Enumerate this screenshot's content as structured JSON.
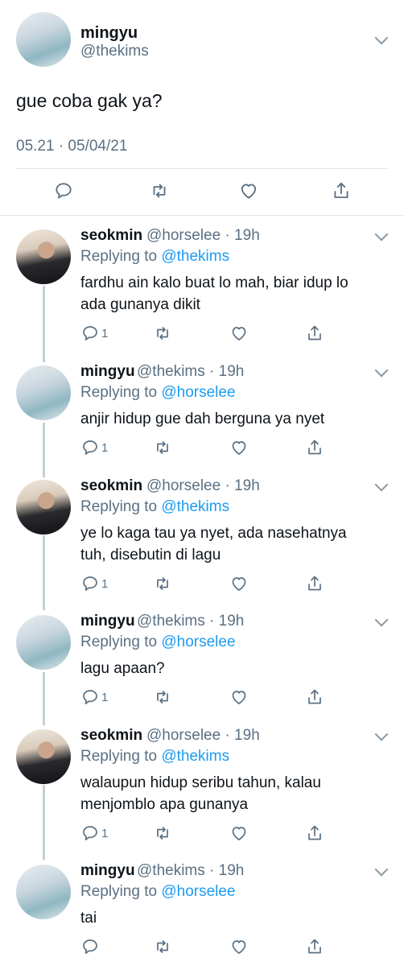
{
  "main_tweet": {
    "name": "mingyu",
    "handle": "@thekims",
    "text": "gue coba gak ya?",
    "timestamp": "05.21 · 05/04/21",
    "avatar": "mingyu-avatar",
    "actions": [
      "reply-icon",
      "retweet-icon",
      "like-icon",
      "share-icon"
    ]
  },
  "replies": [
    {
      "name": "seokmin",
      "meta": "@horselee · 19h",
      "replying_prefix": "Replying to ",
      "replying_to": "@thekims",
      "lines": [
        "fardhu ain kalo buat lo mah, biar idup lo",
        "ada gunanya dikit"
      ],
      "reply_count": "1",
      "avatar": "seokmin-avatar"
    },
    {
      "name": "mingyu",
      "meta": "@thekims · 19h",
      "replying_prefix": "Replying to ",
      "replying_to": "@horselee",
      "lines": [
        "anjir hidup gue dah berguna ya nyet"
      ],
      "reply_count": "1",
      "avatar": "mingyu-avatar"
    },
    {
      "name": "seokmin",
      "meta": "@horselee · 19h",
      "replying_prefix": "Replying to ",
      "replying_to": "@thekims",
      "lines": [
        "ye lo kaga tau ya nyet, ada nasehatnya",
        "tuh, disebutin di lagu"
      ],
      "reply_count": "1",
      "avatar": "seokmin-avatar"
    },
    {
      "name": "mingyu",
      "meta": "@thekims · 19h",
      "replying_prefix": "Replying to ",
      "replying_to": "@horselee",
      "lines": [
        "lagu apaan?"
      ],
      "reply_count": "1",
      "avatar": "mingyu-avatar"
    },
    {
      "name": "seokmin",
      "meta": "@horselee · 19h",
      "replying_prefix": "Replying to ",
      "replying_to": "@thekims",
      "lines": [
        "walaupun hidup seribu tahun, kalau",
        "menjomblo apa gunanya"
      ],
      "reply_count": "1",
      "avatar": "seokmin-avatar"
    },
    {
      "name": "mingyu",
      "meta": "@thekims · 19h",
      "replying_prefix": "Replying to ",
      "replying_to": "@horselee",
      "lines": [
        "tai"
      ],
      "reply_count": "",
      "avatar": "mingyu-avatar"
    }
  ],
  "colors": {
    "link": "#1d9bf0",
    "muted": "#5b7083",
    "divider": "#e1e8ed",
    "thread_line": "#c4cfd6"
  }
}
